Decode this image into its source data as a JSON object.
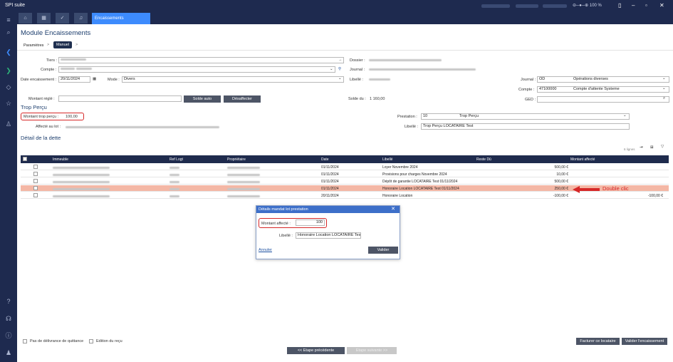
{
  "title_bar": {
    "app_title": "SPI suite",
    "zoom": "100 %"
  },
  "tabs": {
    "active": "Encaissements"
  },
  "module": {
    "title": "Module Encaissements"
  },
  "breadcrumbs": {
    "step1": "Paramètres",
    "step2": "Manuel",
    "sep": ">"
  },
  "form": {
    "tiers_label": "Tiers :",
    "compte_label": "Compte :",
    "date_label": "Date encaissement :",
    "date_value": "20/11/2024",
    "mode_label": "Mode :",
    "mode_value": "Divers",
    "dossier_label": "Dossier :",
    "journal_label": "Journal :",
    "libelle_label": "Libellé :",
    "journal2_label": "Journal :",
    "journal2_code": "OD",
    "journal2_name": "Opérations diverses",
    "compte2_label": "Compte :",
    "compte2_code": "47100000",
    "compte2_name": "Compte d'attente Systeme",
    "ged_label": "GED :",
    "montant_regle_label": "Montant réglé :",
    "solde_auto": "Solde auto",
    "desaffecter": "Désaffecter",
    "solde_du_label": "Solde du :",
    "solde_du_value": "1 160,00"
  },
  "trop_percu": {
    "title": "Trop Perçu",
    "montant_label": "Montant trop perçu :",
    "montant_value": "100,00",
    "affecte_label": "Affecté au lot :",
    "prestation_label": "Prestation :",
    "prestation_code": "10",
    "prestation_name": "Trop Perçu",
    "libelle_label": "Libellé :",
    "libelle_value": "Trop Perçu LOCATAIRE Test"
  },
  "detail": {
    "title": "Détail de la dette",
    "count": "6 lignes",
    "columns": [
      "Immeuble",
      "Ref Logt",
      "Propriétaire",
      "Date",
      "Libellé",
      "Reste Dû",
      "Montant affecté"
    ],
    "rows": [
      {
        "date": "01/11/2024",
        "libelle": "Loyer Novembre      2024",
        "reste": "500,00 €",
        "affecte": ""
      },
      {
        "date": "01/11/2024",
        "libelle": "Provisions pour charges Novembre      2024",
        "reste": "10,00 €",
        "affecte": ""
      },
      {
        "date": "01/11/2024",
        "libelle": "Dépôt de garantie LOCATAIRE Test 01/11/2024",
        "reste": "500,00 €",
        "affecte": ""
      },
      {
        "date": "01/11/2024",
        "libelle": "Honoraire Location LOCATAIRE Test 01/11/2024",
        "reste": "250,00 €",
        "affecte": ""
      },
      {
        "date": "20/11/2024",
        "libelle": "Honoraire Location",
        "reste": "-100,00 €",
        "affecte": "-100,00 €"
      }
    ]
  },
  "annotation": {
    "double_clic": "Double clic"
  },
  "dialog": {
    "title": "Détails mandat lot prestation",
    "montant_label": "Montant affecté :",
    "montant_value": "100",
    "libelle_label": "Libellé :",
    "libelle_value": "Honoraire Location LOCATAIRE Test",
    "annuler": "Annuler",
    "valider": "Valider"
  },
  "footer": {
    "chk1": "Pas de délivrance de quittance",
    "chk2": "Edition du reçu",
    "facturer": "Facturer ce locataire",
    "valider_enc": "Valider l'encaissement",
    "prev": "<< Etape précédente",
    "next": "Etape suivante >>"
  },
  "colors": {
    "navy": "#1e2a4f",
    "accent": "#3d8bfd",
    "highlight": "#d62828",
    "selected_row": "#f4b7a5"
  }
}
